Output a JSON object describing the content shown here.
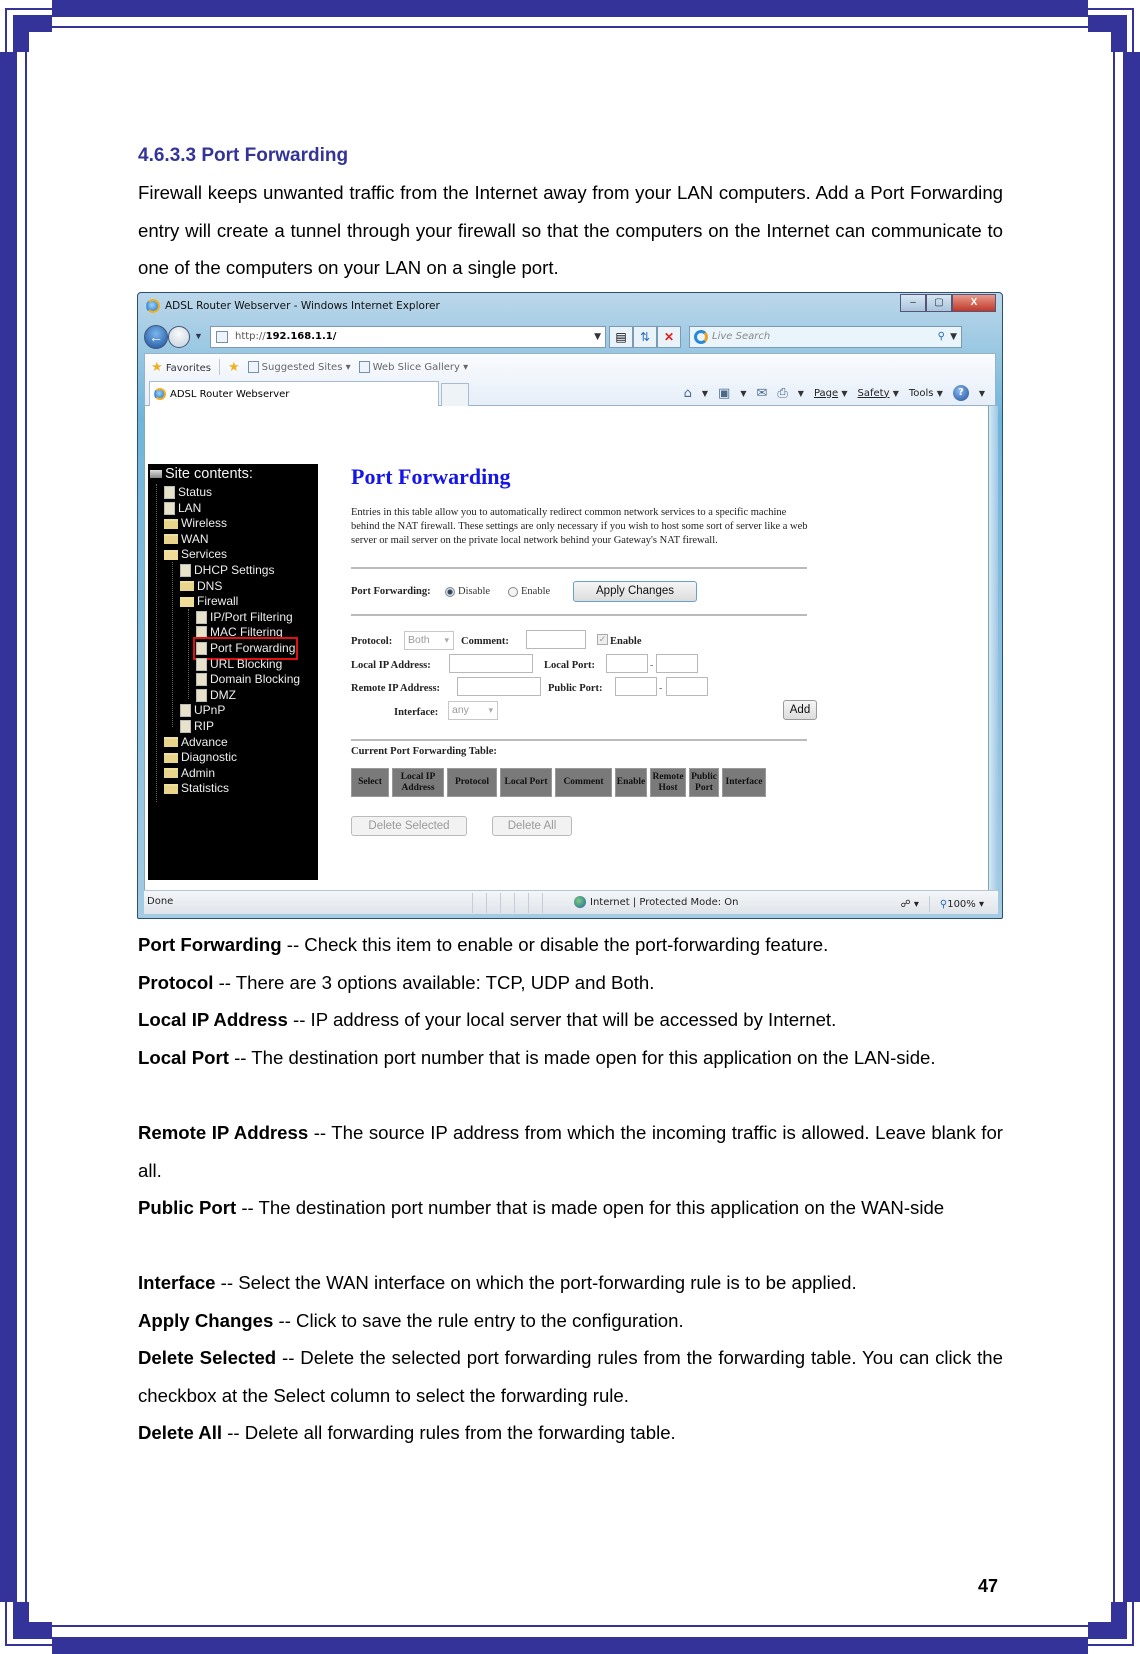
{
  "document": {
    "heading": "4.6.3.3 Port Forwarding",
    "intro": "Firewall keeps unwanted traffic from the Internet away from your LAN computers. Add a Port Forwarding entry will create a tunnel through your firewall so that the computers on the Internet can communicate to one of the computers on your LAN on a single port.",
    "definitions": [
      {
        "term": "Port Forwarding",
        "text": " -- Check this item to enable or disable the port-forwarding feature."
      },
      {
        "term": "Protocol",
        "text": " -- There are 3 options available: TCP, UDP and Both."
      },
      {
        "term": "Local IP Address",
        "text": " -- IP address of your local server that will be accessed by Internet."
      },
      {
        "term": "Local Port",
        "text": " -- The destination port number that is made open for this application on the LAN-side."
      },
      {
        "term": "Remote IP Address",
        "text": " -- The source IP address from which the incoming traffic is allowed. Leave blank for all."
      },
      {
        "term": "Public Port",
        "text": " -- The destination port number that is made open for this application on the WAN-side"
      },
      {
        "term": "Interface",
        "text": " -- Select the WAN interface on which the port-forwarding rule is to be applied."
      },
      {
        "term": "Apply Changes",
        "text": " -- Click to save the rule entry to the configuration."
      },
      {
        "term": "Delete Selected",
        "text": " -- Delete the selected port forwarding rules from the forwarding table. You can click the checkbox at the Select column to select the forwarding rule."
      },
      {
        "term": "Delete All",
        "text": " -- Delete all forwarding rules from the forwarding table."
      }
    ],
    "page_number": "47",
    "accent_color": "#333399"
  },
  "browser": {
    "window_title": "ADSL Router Webserver - Windows Internet Explorer",
    "window_buttons": {
      "minimize": "–",
      "maximize": "▢",
      "close": "X"
    },
    "address_prefix": "http://",
    "address_host": "192.168.1.1/",
    "search_placeholder": "Live Search",
    "favorites_label": "Favorites",
    "suggested_sites": "Suggested Sites ▾",
    "web_slice_gallery": "Web Slice Gallery ▾",
    "tab_title": "ADSL Router Webserver",
    "commands": {
      "page": "Page",
      "safety": "Safety",
      "tools": "Tools"
    },
    "status_left": "Done",
    "status_zone": "Internet | Protected Mode: On",
    "zoom_level": "100%"
  },
  "router": {
    "tree_title": "Site contents:",
    "tree": [
      {
        "label": "Status",
        "icon": "doc"
      },
      {
        "label": "LAN",
        "icon": "doc"
      },
      {
        "label": "Wireless",
        "icon": "folder"
      },
      {
        "label": "WAN",
        "icon": "folder"
      },
      {
        "label": "Services",
        "icon": "folder-open"
      },
      {
        "label": "DHCP Settings",
        "icon": "doc"
      },
      {
        "label": "DNS",
        "icon": "folder"
      },
      {
        "label": "Firewall",
        "icon": "folder-open"
      },
      {
        "label": "IP/Port Filtering",
        "icon": "doc"
      },
      {
        "label": "MAC Filtering",
        "icon": "doc"
      },
      {
        "label": "Port Forwarding",
        "icon": "doc",
        "selected": true
      },
      {
        "label": "URL Blocking",
        "icon": "doc"
      },
      {
        "label": "Domain Blocking",
        "icon": "doc"
      },
      {
        "label": "DMZ",
        "icon": "doc"
      },
      {
        "label": "UPnP",
        "icon": "doc"
      },
      {
        "label": "RIP",
        "icon": "doc"
      },
      {
        "label": "Advance",
        "icon": "folder"
      },
      {
        "label": "Diagnostic",
        "icon": "folder"
      },
      {
        "label": "Admin",
        "icon": "folder"
      },
      {
        "label": "Statistics",
        "icon": "folder"
      }
    ],
    "page_title": "Port Forwarding",
    "description": "Entries in this table allow you to automatically redirect common network services to a specific machine behind the NAT firewall. These settings are only necessary if you wish to host some sort of server like a web server or mail server on the private local network behind your Gateway's NAT firewall.",
    "port_forwarding_label": "Port Forwarding:",
    "radio_disable": "Disable",
    "radio_enable": "Enable",
    "selected_mode": "Disable",
    "apply_button": "Apply Changes",
    "protocol_label": "Protocol:",
    "protocol_value": "Both",
    "comment_label": "Comment:",
    "comment_value": "",
    "enable_label": "Enable",
    "enable_checked": true,
    "local_ip_label": "Local IP Address:",
    "local_ip_value": "",
    "local_port_label": "Local Port:",
    "remote_ip_label": "Remote IP Address:",
    "remote_ip_value": "",
    "public_port_label": "Public Port:",
    "interface_label": "Interface:",
    "interface_value": "any",
    "add_button": "Add",
    "table_title": "Current Port Forwarding Table:",
    "table_columns": [
      "Select",
      "Local IP Address",
      "Protocol",
      "Local Port",
      "Comment",
      "Enable",
      "Remote Host",
      "Public Port",
      "Interface"
    ],
    "delete_selected_button": "Delete Selected",
    "delete_all_button": "Delete All"
  }
}
